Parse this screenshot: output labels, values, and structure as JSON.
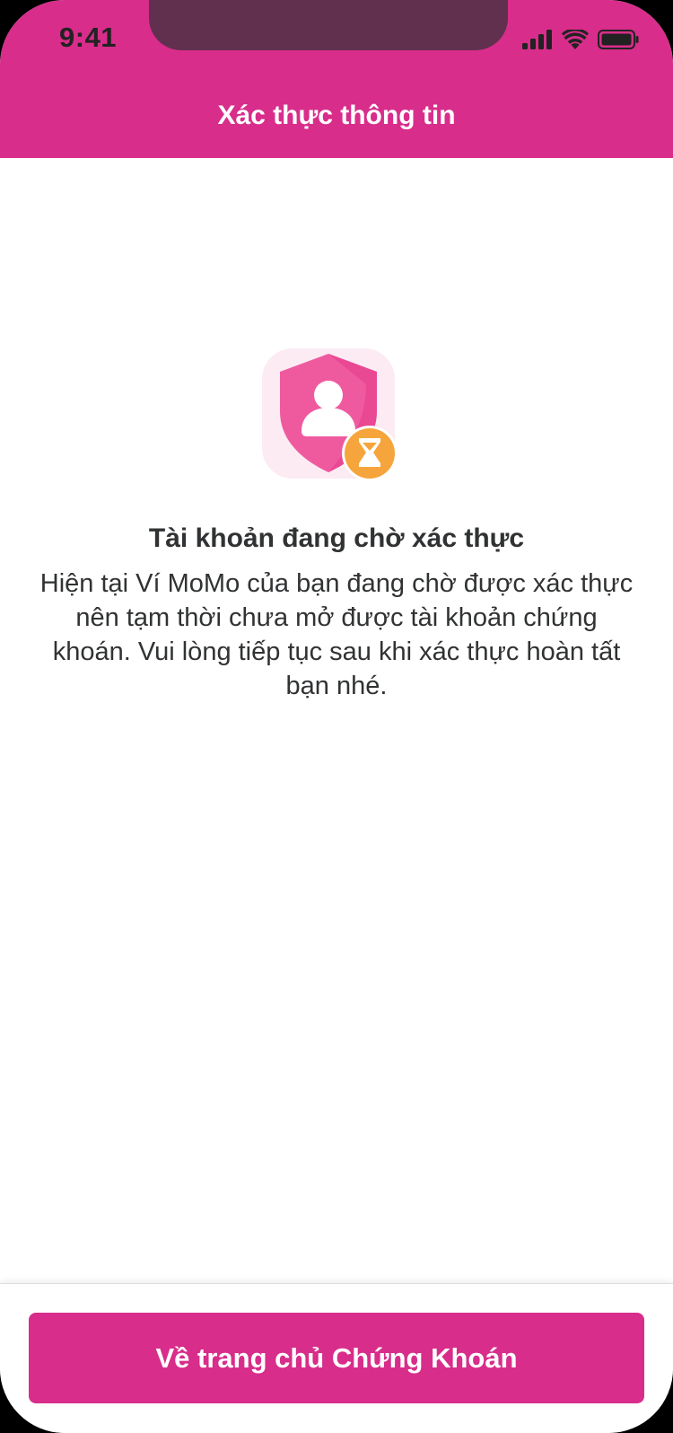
{
  "status_bar": {
    "time": "9:41",
    "icons": [
      "signal-icon",
      "wifi-icon",
      "battery-icon"
    ]
  },
  "header": {
    "title": "Xác thực thông tin"
  },
  "message": {
    "illustration": "shield-user-pending-icon",
    "title": "Tài khoản đang chờ xác thực",
    "body": "Hiện tại Ví MoMo của bạn đang chờ được xác thực nên tạm thời chưa mở được tài khoản chứng khoán. Vui lòng tiếp tục sau khi xác thực hoàn tất bạn nhé."
  },
  "footer": {
    "button_label": "Về trang chủ Chứng Khoán"
  },
  "colors": {
    "brand": "#d82d8b",
    "text": "#303233",
    "pending_badge": "#f6a53c"
  }
}
